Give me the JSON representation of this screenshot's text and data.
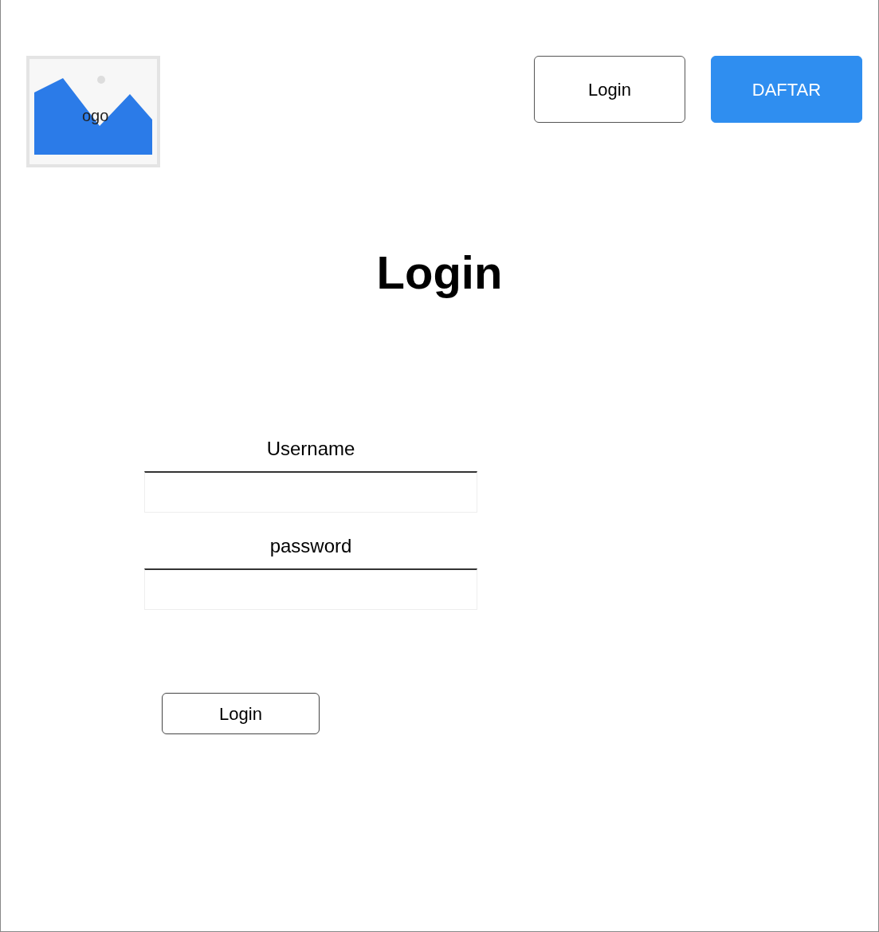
{
  "logo": {
    "label": "ogo"
  },
  "nav_buttons": [
    {
      "label": "Login",
      "kind": "outline"
    },
    {
      "label": "DAFTAR",
      "kind": "primary"
    }
  ],
  "title": "Login",
  "form": {
    "fields": [
      {
        "label": "Username"
      },
      {
        "label": "password"
      }
    ],
    "submit": "Login"
  }
}
